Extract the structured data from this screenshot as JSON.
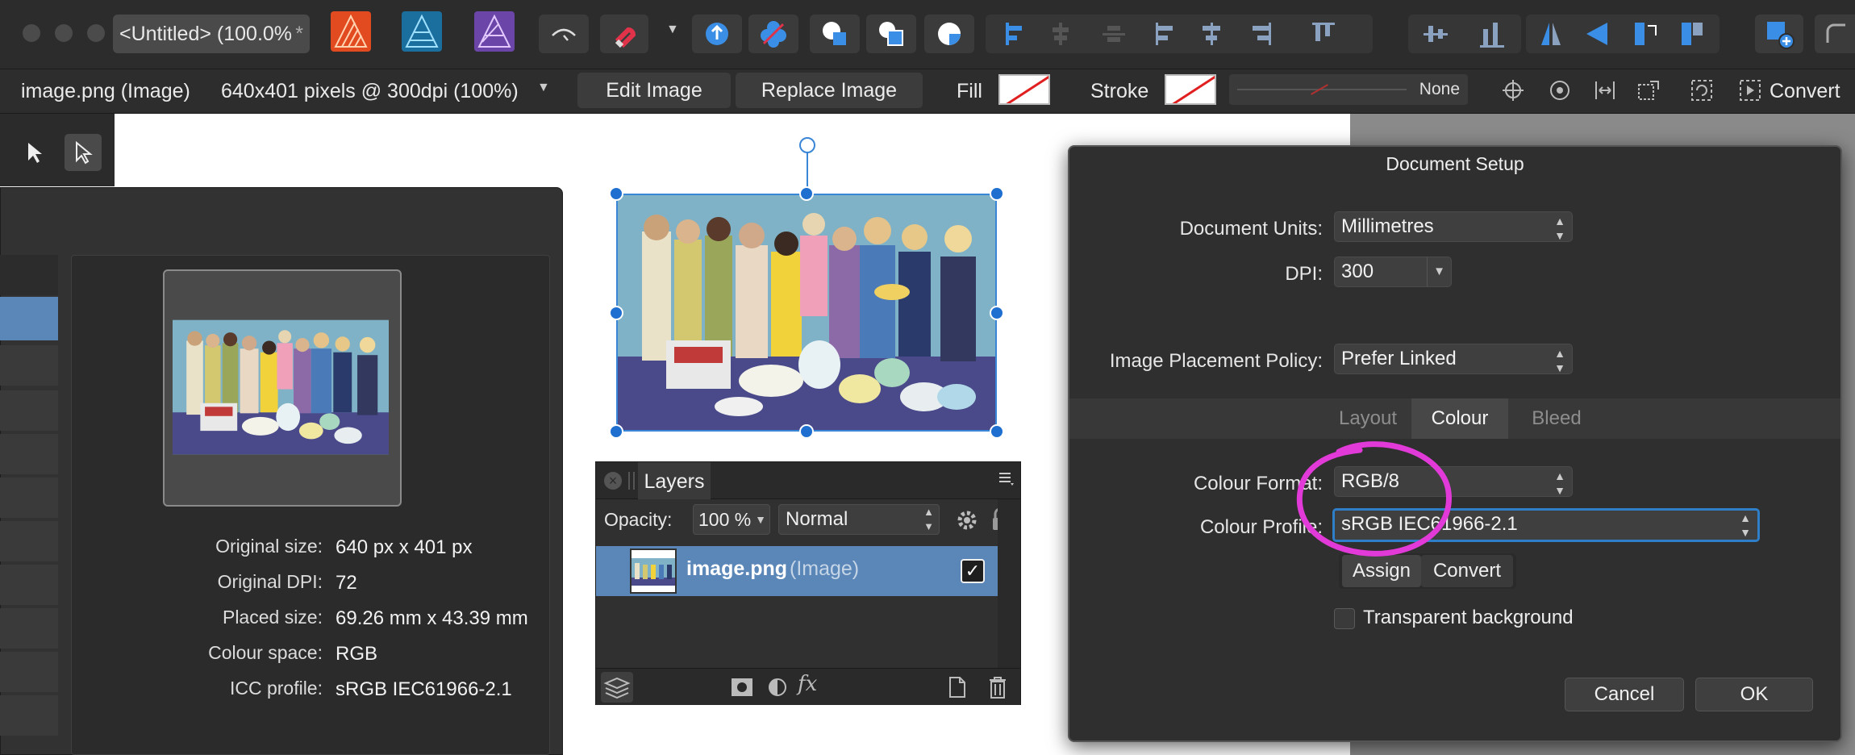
{
  "window": {
    "doc_tab_title": "<Untitled> (100.0%",
    "doc_tab_close": "*"
  },
  "context_toolbar": {
    "layer_name": "image.png (Image)",
    "image_info": "640x401 pixels @ 300dpi (100%)",
    "edit_image": "Edit Image",
    "replace_image": "Replace Image",
    "fill_label": "Fill",
    "stroke_label": "Stroke",
    "stroke_value": "None",
    "convert_label": "Convert"
  },
  "image_info_panel": {
    "rows": [
      {
        "label": "Original size:",
        "value": "640 px x 401 px"
      },
      {
        "label": "Original DPI:",
        "value": "72"
      },
      {
        "label": "Placed size:",
        "value": "69.26 mm x 43.39 mm"
      },
      {
        "label": "Colour space:",
        "value": "RGB"
      },
      {
        "label": "ICC profile:",
        "value": "sRGB IEC61966-2.1"
      }
    ]
  },
  "layers_panel": {
    "title": "Layers",
    "opacity_label": "Opacity:",
    "opacity_value": "100 %",
    "blend_mode": "Normal",
    "layer_name": "image.png",
    "layer_type": "(Image)",
    "check_mark": "✓",
    "fx_label": "fx"
  },
  "document_setup": {
    "title": "Document Setup",
    "units_label": "Document Units:",
    "units_value": "Millimetres",
    "dpi_label": "DPI:",
    "dpi_value": "300",
    "placement_label": "Image Placement Policy:",
    "placement_value": "Prefer Linked",
    "tabs": [
      "Layout",
      "Colour",
      "Bleed"
    ],
    "active_tab": "Colour",
    "colour_format_label": "Colour Format:",
    "colour_format_value": "RGB/8",
    "colour_profile_label": "Colour Profile:",
    "colour_profile_value": "sRGB IEC61966-2.1",
    "assign_label": "Assign",
    "convert_label": "Convert",
    "transparent_label": "Transparent background",
    "cancel_label": "Cancel",
    "ok_label": "OK"
  },
  "colors": {
    "accent": "#3a86d6",
    "selection_row": "#5a86b8",
    "annotation_circle": "#e23ad8",
    "designer": "#1a7fb0",
    "photo": "#7a4fb0",
    "publisher": "#e24a1f"
  }
}
